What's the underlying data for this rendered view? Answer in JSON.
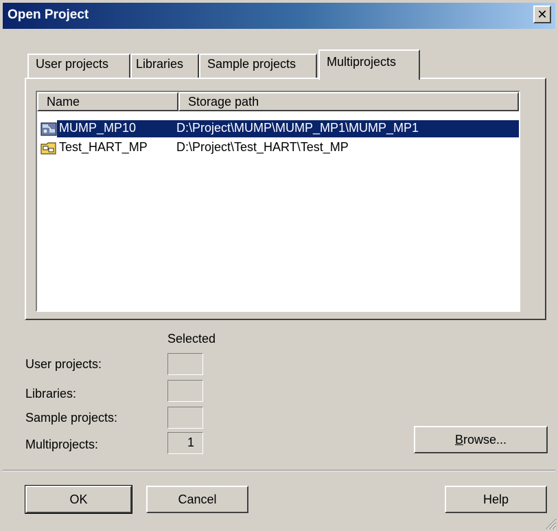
{
  "window": {
    "title": "Open Project",
    "close_glyph": "✕"
  },
  "tabs": [
    {
      "label": "User projects"
    },
    {
      "label": "Libraries"
    },
    {
      "label": "Sample projects"
    },
    {
      "label": "Multiprojects",
      "active": true
    }
  ],
  "list": {
    "columns": [
      "Name",
      "Storage path"
    ],
    "rows": [
      {
        "name": "MUMP_MP10",
        "path": "D:\\Project\\MUMP\\MUMP_MP1\\MUMP_MP1",
        "icon": "multiproject-icon",
        "selected": true
      },
      {
        "name": "Test_HART_MP",
        "path": "D:\\Project\\Test_HART\\Test_MP",
        "icon": "multiproject-folder-icon",
        "selected": false
      }
    ]
  },
  "selected_summary": {
    "header": "Selected",
    "rows": [
      {
        "label": "User projects:",
        "count": ""
      },
      {
        "label": "Libraries:",
        "count": ""
      },
      {
        "label": "Sample projects:",
        "count": ""
      },
      {
        "label": "Multiprojects:",
        "count": "1"
      }
    ]
  },
  "buttons": {
    "browse": "Browse...",
    "ok": "OK",
    "cancel": "Cancel",
    "help": "Help"
  },
  "colors": {
    "selection": "#0a246a",
    "dialog_bg": "#d4d0c8"
  }
}
